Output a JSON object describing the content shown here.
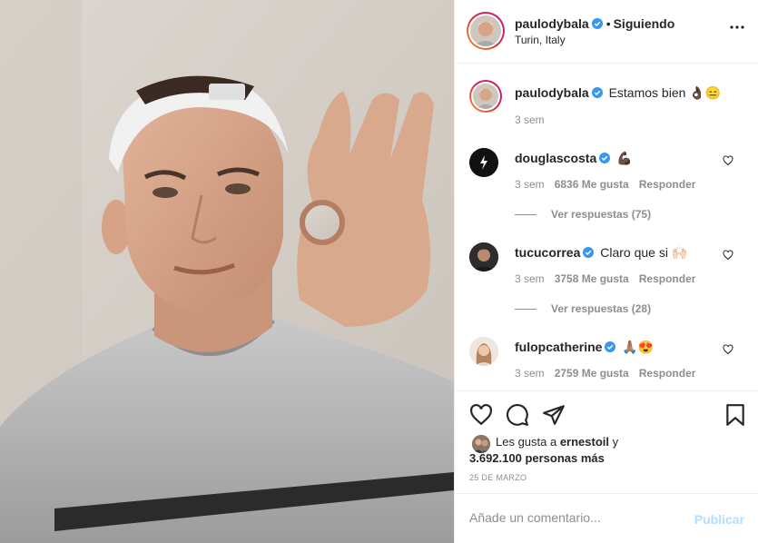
{
  "post": {
    "author": "paulodybala",
    "follow_separator": "•",
    "follow_state": "Siguiendo",
    "location": "Turin, Italy"
  },
  "caption": {
    "author": "paulodybala",
    "text": "Estamos bien 👌🏿😑",
    "time": "3 sem"
  },
  "comments": [
    {
      "author": "douglascosta",
      "text": "💪🏿",
      "time": "3 sem",
      "likes": "6836 Me gusta",
      "reply": "Responder",
      "view_replies": "Ver respuestas (75)"
    },
    {
      "author": "tucucorrea",
      "text": "Claro que si 🙌🏻",
      "time": "3 sem",
      "likes": "3758 Me gusta",
      "reply": "Responder",
      "view_replies": "Ver respuestas (28)"
    },
    {
      "author": "fulopcatherine",
      "text": "🙏🏽😍",
      "time": "3 sem",
      "likes": "2759 Me gusta",
      "reply": "Responder"
    }
  ],
  "likes": {
    "prefix": "Les gusta a ",
    "user": "ernestoil",
    "suffix": " y",
    "count": "3.692.100 personas más"
  },
  "date": "25 DE MARZO",
  "composer": {
    "placeholder": "Añade un comentario...",
    "publish_label": "Publicar"
  },
  "colors": {
    "verified": "#3897f0",
    "publish_disabled": "#b2dffc",
    "meta_gray": "#8e8e8e"
  },
  "icons": [
    "verified-badge-icon",
    "more-options-icon",
    "heart-icon",
    "comment-icon",
    "share-icon",
    "bookmark-icon"
  ]
}
